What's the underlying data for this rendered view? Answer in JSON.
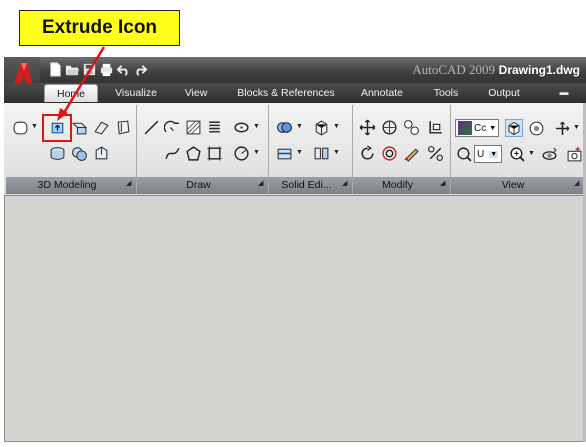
{
  "callout": {
    "text": "Extrude Icon"
  },
  "titlebar": {
    "app_name": "AutoCAD 2009",
    "document": "Drawing1.dwg"
  },
  "tabs": [
    {
      "label": "Home"
    },
    {
      "label": "Visualize"
    },
    {
      "label": "View"
    },
    {
      "label": "Blocks & References"
    },
    {
      "label": "Annotate"
    },
    {
      "label": "Tools"
    },
    {
      "label": "Output"
    }
  ],
  "panels": [
    {
      "title": "3D Modeling"
    },
    {
      "title": "Draw"
    },
    {
      "title": "Solid Edi..."
    },
    {
      "title": "Modify"
    },
    {
      "title": "View"
    }
  ],
  "view_panel": {
    "visual_style": "Cc",
    "ucs": "U"
  },
  "colors": {
    "highlight": "#e01414",
    "callout_bg": "#ffff1a",
    "titlebar": "#3e3e3e",
    "canvas": "#d4d4d0"
  }
}
